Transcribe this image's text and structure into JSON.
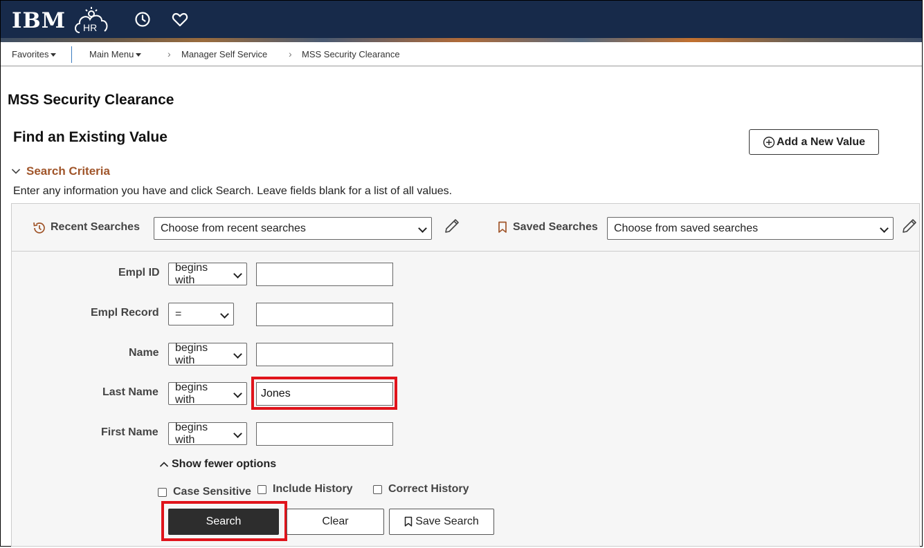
{
  "header": {
    "logo_text": "IBM",
    "hr_logo_text": "HR",
    "history_icon": "clock-icon",
    "favorite_icon": "heart-icon",
    "bg_color": "#172a4a"
  },
  "breadcrumb": {
    "favorites": "Favorites",
    "main_menu": "Main Menu",
    "manager_self_service": "Manager Self Service",
    "current": "MSS Security Clearance"
  },
  "page": {
    "title": "MSS Security Clearance",
    "find_title": "Find an Existing Value",
    "add_new_label": "Add a New Value",
    "criteria_label": "Search Criteria",
    "instructions": "Enter any information you have and click Search. Leave fields blank for a list of all values."
  },
  "searches": {
    "recent_label": "Recent Searches",
    "recent_value": "Choose from recent searches",
    "saved_label": "Saved Searches",
    "saved_value": "Choose from saved searches"
  },
  "fields": {
    "empl_id": {
      "label": "Empl ID",
      "operator": "begins with",
      "value": ""
    },
    "empl_record": {
      "label": "Empl Record",
      "operator": "=",
      "value": ""
    },
    "name": {
      "label": "Name",
      "operator": "begins with",
      "value": ""
    },
    "last_name": {
      "label": "Last Name",
      "operator": "begins with",
      "value": "Jones"
    },
    "first_name": {
      "label": "First Name",
      "operator": "begins with",
      "value": ""
    }
  },
  "options": {
    "toggle_label": "Show fewer options",
    "case_sensitive": {
      "label": "Case Sensitive",
      "checked": false
    },
    "include_history": {
      "label": "Include History",
      "checked": false
    },
    "correct_history": {
      "label": "Correct History",
      "checked": false
    }
  },
  "buttons": {
    "search": "Search",
    "clear": "Clear",
    "save_search": "Save Search"
  },
  "colors": {
    "accent": "#a0552a",
    "highlight": "#e0141b",
    "primary_button": "#2d2d2d"
  }
}
